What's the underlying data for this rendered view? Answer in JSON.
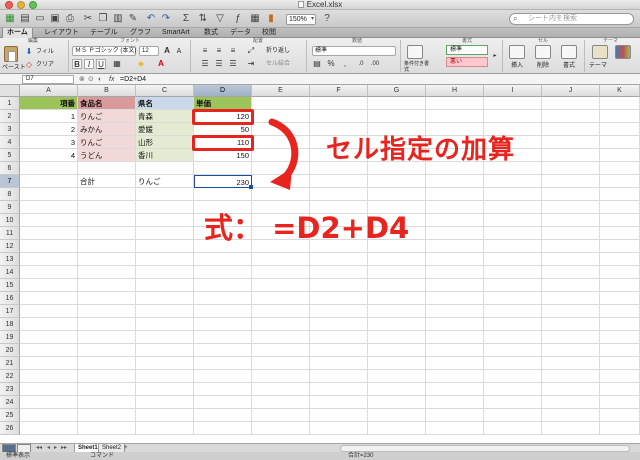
{
  "window": {
    "title": "Excel.xlsx"
  },
  "toolbar": {
    "zoom": "150%",
    "search_placeholder": "シート内を検索"
  },
  "ribbon_tabs": [
    "ホーム",
    "レイアウト",
    "テーブル",
    "グラフ",
    "SmartArt",
    "数式",
    "データ",
    "校閲"
  ],
  "ribbon": {
    "groups": [
      "編集",
      "フォント",
      "配置",
      "数値",
      "書式",
      "セル",
      "テーマ"
    ],
    "fill_label": "フィル",
    "clear_label": "クリア",
    "paste_label": "ペースト",
    "font_name": "ＭＳ Ｐゴシック (本文)",
    "font_size": "12",
    "wrap_label": "折り返し",
    "merge_label": "セル結合",
    "number_format": "標準",
    "conditional_label": "条件付き書式",
    "style_normal": "標準",
    "style_bad": "悪い",
    "insert_label": "挿入",
    "delete_label": "削除",
    "format_label": "書式",
    "theme_label": "テーマ"
  },
  "formula_bar": {
    "cell_ref": "D7",
    "formula": "=D2+D4"
  },
  "columns": [
    "A",
    "B",
    "C",
    "D",
    "E",
    "F",
    "G",
    "H",
    "I",
    "J",
    "K"
  ],
  "rows": [
    "1",
    "2",
    "3",
    "4",
    "5",
    "6",
    "7",
    "8",
    "9",
    "10",
    "11",
    "12",
    "13",
    "14",
    "15",
    "16",
    "17",
    "18",
    "19",
    "20",
    "21",
    "22",
    "23",
    "24",
    "25",
    "26"
  ],
  "cells": {
    "a1": "項番",
    "b1": "食品名",
    "c1": "県名",
    "d1": "単価",
    "a2": "1",
    "b2": "りんご",
    "c2": "青森",
    "d2": "120",
    "a3": "2",
    "b3": "みかん",
    "c3": "愛媛",
    "d3": "50",
    "a4": "3",
    "b4": "りんご",
    "c4": "山形",
    "d4": "110",
    "a5": "4",
    "b5": "うどん",
    "c5": "香川",
    "d5": "150",
    "b7": "合計",
    "c7": "りんご",
    "d7": "230"
  },
  "annotations": {
    "title": "セル指定の加算",
    "formula": "式：  =D2+D4"
  },
  "sheets": [
    "Sheet1",
    "Sheet2"
  ],
  "status": {
    "view": "標準表示",
    "mode": "コマンド",
    "sum": "合計=230"
  }
}
